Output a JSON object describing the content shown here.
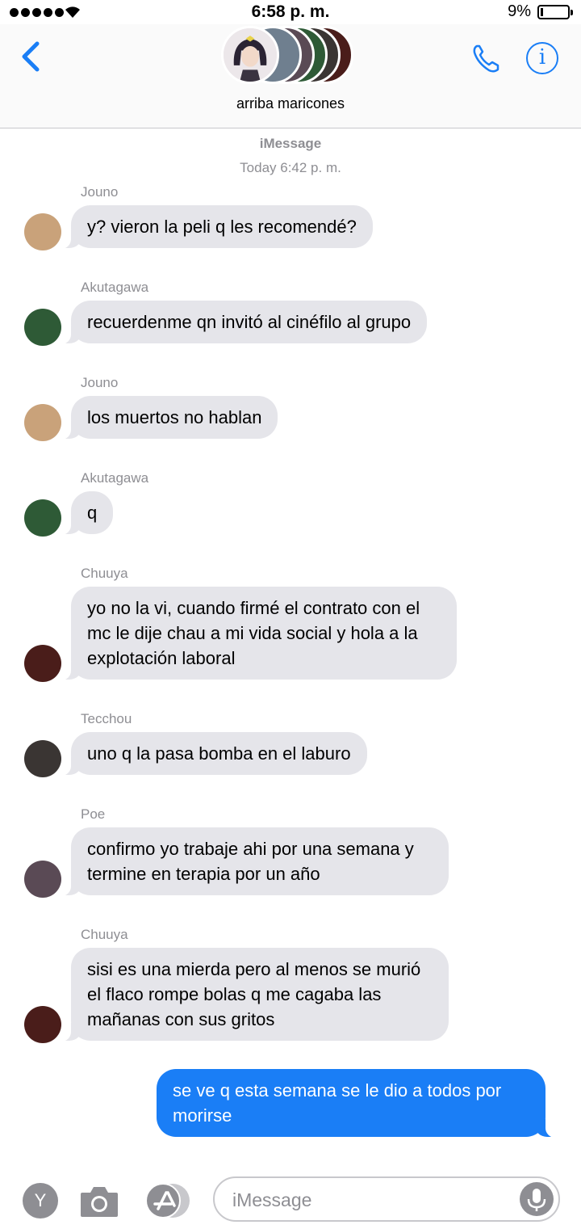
{
  "status_bar": {
    "time": "6:58 p. m.",
    "battery_percent": "9%",
    "signal_bars": 5
  },
  "header": {
    "group_name": "arriba maricones",
    "icons": [
      "back-chevron-icon",
      "phone-icon",
      "info-icon"
    ]
  },
  "conversation": {
    "service": "iMessage",
    "timestamp": "Today 6:42 p. m.",
    "messages": [
      {
        "sender": "Jouno",
        "text": "y? vieron la peli q les recomendé?",
        "avatar_color": "#c9a27a"
      },
      {
        "sender": "Akutagawa",
        "text": "recuerdenme qn invitó al cinéfilo al grupo",
        "avatar_color": "#2e5a36"
      },
      {
        "sender": "Jouno",
        "text": "los muertos no hablan",
        "avatar_color": "#c9a27a"
      },
      {
        "sender": "Akutagawa",
        "text": "q",
        "avatar_color": "#2e5a36"
      },
      {
        "sender": "Chuuya",
        "text": "yo no la vi, cuando firmé el contrato con el mc le dije chau a mi vida social y hola a la explotación laboral",
        "avatar_color": "#4a1d1a"
      },
      {
        "sender": "Tecchou",
        "text": "uno q la pasa bomba en el laburo",
        "avatar_color": "#3a3533"
      },
      {
        "sender": "Poe",
        "text": "confirmo yo trabaje ahi por una semana y termine en terapia por un año",
        "avatar_color": "#5a4a55"
      },
      {
        "sender": "Chuuya",
        "text": "sisi es una mierda pero al menos se murió el flaco rompe bolas q me cagaba las mañanas con sus gritos",
        "avatar_color": "#4a1d1a"
      }
    ],
    "sent_message": "se ve q esta semana se le dio a todos por morirse"
  },
  "composer": {
    "placeholder": "iMessage",
    "app_button_label": "Y",
    "icons": [
      "camera-icon",
      "app-store-icon",
      "microphone-icon"
    ]
  },
  "colors": {
    "accent": "#1a7ef6",
    "received_bubble": "#e5e5ea",
    "meta_text": "#8e8e93"
  }
}
